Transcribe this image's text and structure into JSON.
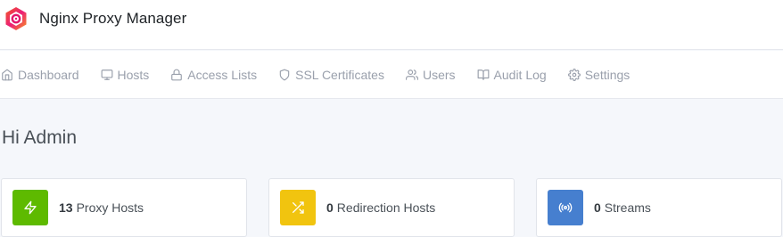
{
  "app": {
    "title": "Nginx Proxy Manager"
  },
  "nav": {
    "items": [
      {
        "label": "Dashboard",
        "icon": "home-icon"
      },
      {
        "label": "Hosts",
        "icon": "monitor-icon"
      },
      {
        "label": "Access Lists",
        "icon": "lock-icon"
      },
      {
        "label": "SSL Certificates",
        "icon": "shield-icon"
      },
      {
        "label": "Users",
        "icon": "users-icon"
      },
      {
        "label": "Audit Log",
        "icon": "book-open-icon"
      },
      {
        "label": "Settings",
        "icon": "gear-icon"
      }
    ]
  },
  "main": {
    "greeting": "Hi Admin",
    "cards": [
      {
        "count": "13",
        "label": "Proxy Hosts",
        "icon": "zap-icon",
        "color": "#5eba00"
      },
      {
        "count": "0",
        "label": "Redirection Hosts",
        "icon": "shuffle-icon",
        "color": "#f1c40f"
      },
      {
        "count": "0",
        "label": "Streams",
        "icon": "radio-icon",
        "color": "#467fcf"
      }
    ]
  },
  "colors": {
    "accent": "#5eba00",
    "page_background": "#f5f7fb",
    "nav_text": "#9aa0ac"
  }
}
